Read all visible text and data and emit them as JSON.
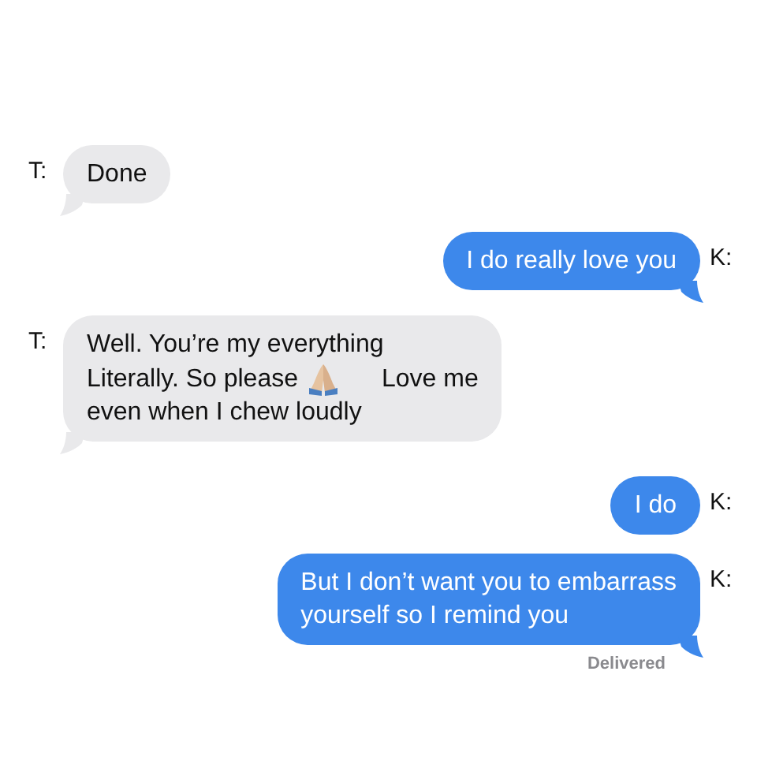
{
  "messages": [
    {
      "sender": "T:",
      "kind": "incoming",
      "tail": true,
      "lines": [
        [
          {
            "kind": "text",
            "text": "Done"
          }
        ]
      ]
    },
    {
      "sender": "K:",
      "kind": "outgoing",
      "tail": true,
      "lines": [
        [
          {
            "kind": "text",
            "text": "I do really love you"
          }
        ]
      ]
    },
    {
      "sender": "T:",
      "kind": "incoming",
      "tail": true,
      "lines": [
        [
          {
            "kind": "text",
            "text": "Well. You’re my everything"
          }
        ],
        [
          {
            "kind": "text",
            "text": "Literally. So please"
          },
          {
            "kind": "emoji"
          },
          {
            "kind": "text",
            "text": "Love me"
          }
        ],
        [
          {
            "kind": "text",
            "text": "even when I chew loudly"
          }
        ]
      ]
    },
    {
      "sender": "K:",
      "kind": "outgoing",
      "tail": false,
      "lines": [
        [
          {
            "kind": "text",
            "text": "I do"
          }
        ]
      ]
    },
    {
      "sender": "K:",
      "kind": "outgoing",
      "tail": true,
      "lines": [
        [
          {
            "kind": "text",
            "text": "But I don’t want you to embarrass"
          }
        ],
        [
          {
            "kind": "text",
            "text": "yourself so I remind you"
          }
        ]
      ]
    }
  ],
  "status": "Delivered"
}
